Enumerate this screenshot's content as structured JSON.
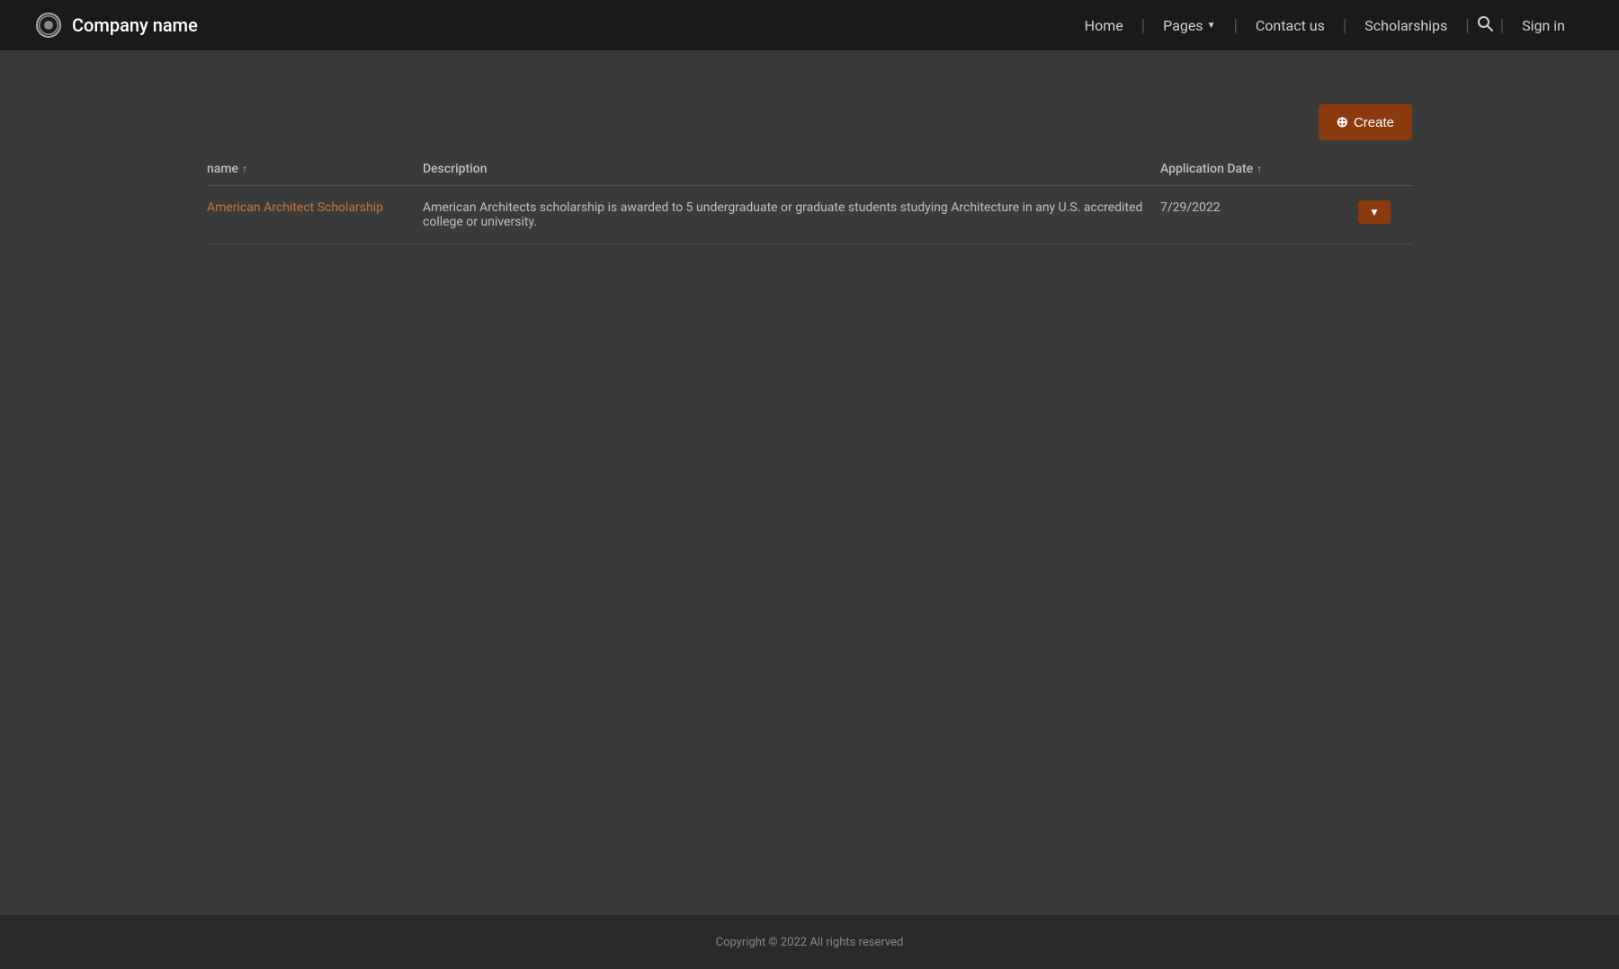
{
  "navbar": {
    "brand_name": "Company name",
    "nav_items": [
      {
        "label": "Home",
        "id": "home"
      },
      {
        "label": "Pages",
        "id": "pages",
        "has_dropdown": true
      },
      {
        "label": "Contact us",
        "id": "contact"
      },
      {
        "label": "Scholarships",
        "id": "scholarships"
      }
    ],
    "signin_label": "Sign in",
    "search_icon": "🔍"
  },
  "toolbar": {
    "create_label": "Create",
    "create_icon": "+"
  },
  "table": {
    "columns": [
      {
        "label": "name",
        "sortable": true,
        "id": "name"
      },
      {
        "label": "Description",
        "sortable": false,
        "id": "description"
      },
      {
        "label": "Application Date",
        "sortable": true,
        "id": "application_date"
      },
      {
        "label": "",
        "id": "actions"
      }
    ],
    "rows": [
      {
        "name": "American Architect Scholarship",
        "description": "American Architects scholarship is awarded to 5 undergraduate or graduate students studying Architecture in any U.S. accredited college or university.",
        "application_date": "7/29/2022"
      }
    ]
  },
  "footer": {
    "copyright": "Copyright © 2022  All rights reserved"
  },
  "colors": {
    "accent": "#8b3a0f",
    "link_color": "#c0763a",
    "navbar_bg": "#1a1a1a",
    "body_bg": "#3a3a3a"
  }
}
